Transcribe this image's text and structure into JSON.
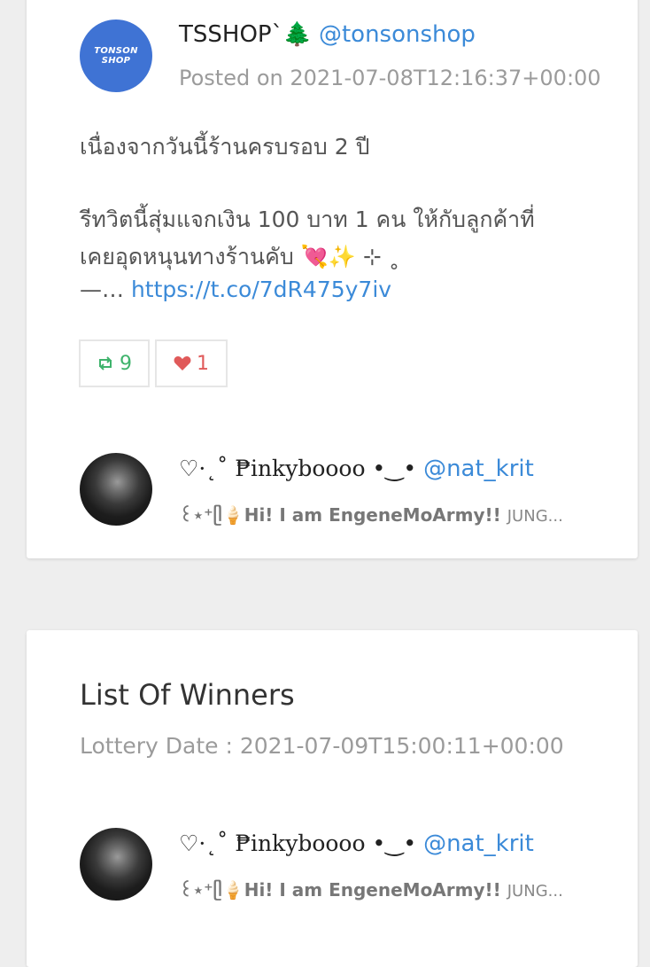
{
  "tweet": {
    "author_name": "TSSHOP`🌲",
    "author_handle": "@tonsonshop",
    "avatar_text_line1": "TONSON",
    "avatar_text_line2": "SHOP",
    "posted": "Posted on 2021-07-08T12:16:37+00:00",
    "text_line1": "เนื่องจากวันนี้ร้านครบรอบ 2 ปี",
    "text_line2": "รีทวิตนี้สุ่มแจกเงิน 100 บาท 1 คน ให้กับลูกค้าที่",
    "text_line3": "เคยอุดหนุนทางร้านคับ 💘✨ ⊹ ˳",
    "text_line4_prefix": "—…",
    "link": "https://t.co/7dR475y7iv",
    "retweets": "9",
    "likes": "1",
    "retweet_icon": "retweet-icon",
    "like_icon": "heart-icon"
  },
  "participant": {
    "name": "♡·˛˚ ₱inkyboooo •‿•",
    "handle": "@nat_krit",
    "bio": "꒰⋆⁺ᥫ🍦Hi! I am EngeneMoArmy!!",
    "bio_tail": "JUNG..."
  },
  "winners": {
    "title": "List Of Winners",
    "lottery_date": "Lottery Date : 2021-07-09T15:00:11+00:00",
    "winner": {
      "name": "♡·˛˚ ₱inkyboooo •‿•",
      "handle": "@nat_krit",
      "bio": "꒰⋆⁺ᥫ🍦Hi! I am EngeneMoArmy!!",
      "bio_tail": "JUNG..."
    }
  },
  "colors": {
    "link": "#3b8ad8",
    "retweet": "#3fb36c",
    "like": "#e05a5a",
    "shop_avatar": "#3f73d4"
  }
}
